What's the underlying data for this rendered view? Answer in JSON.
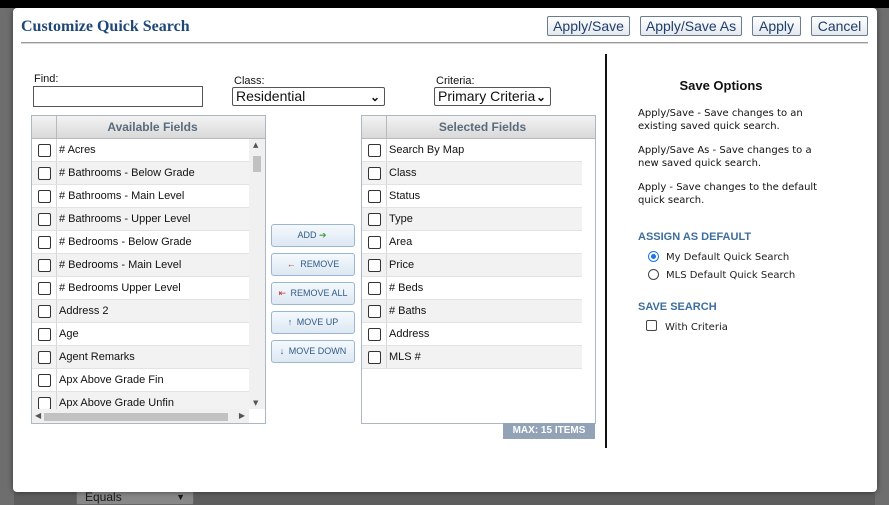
{
  "dialog": {
    "title": "Customize Quick Search",
    "buttons": {
      "apply_save": "Apply/Save",
      "apply_save_as": "Apply/Save As",
      "apply": "Apply",
      "cancel": "Cancel"
    }
  },
  "filters": {
    "find_label": "Find:",
    "find_value": "",
    "class_label": "Class:",
    "class_value": "Residential",
    "criteria_label": "Criteria:",
    "criteria_value": "Primary Criteria"
  },
  "available_fields": {
    "header": "Available Fields",
    "items": [
      "# Acres",
      "# Bathrooms - Below Grade",
      "# Bathrooms - Main Level",
      "# Bathrooms - Upper Level",
      "# Bedrooms - Below Grade",
      "# Bedrooms - Main Level",
      "# Bedrooms Upper Level",
      "Address 2",
      "Age",
      "Agent Remarks",
      "Apx Above Grade Fin",
      "Apx Above Grade Unfin"
    ]
  },
  "move_buttons": {
    "add": "ADD",
    "remove": "REMOVE",
    "remove_all": "REMOVE ALL",
    "move_up": "MOVE UP",
    "move_down": "MOVE DOWN"
  },
  "selected_fields": {
    "header": "Selected Fields",
    "items": [
      "Search By Map",
      "Class",
      "Status",
      "Type",
      "Area",
      "Price",
      "# Beds",
      "# Baths",
      "Address",
      "MLS #"
    ],
    "max_label": "MAX: 15 ITEMS"
  },
  "save_options": {
    "title": "Save Options",
    "desc_apply_save": "Apply/Save - Save changes to an existing saved quick search.",
    "desc_apply_save_as": "Apply/Save As - Save changes to a new saved quick search.",
    "desc_apply": "Apply - Save changes to the default quick search.",
    "assign_default_heading": "ASSIGN AS DEFAULT",
    "radio_my_default": "My Default Quick Search",
    "radio_mls_default": "MLS Default Quick Search",
    "radio_selected": "my_default",
    "save_search_heading": "SAVE SEARCH",
    "with_criteria": "With Criteria",
    "with_criteria_checked": false
  },
  "background": {
    "bottom_select_value": "Equals"
  },
  "colors": {
    "title": "#1f4878",
    "section_heading": "#3c6e9e",
    "max_badge": "#93a3b7",
    "radio_selected": "#1a73e8"
  }
}
